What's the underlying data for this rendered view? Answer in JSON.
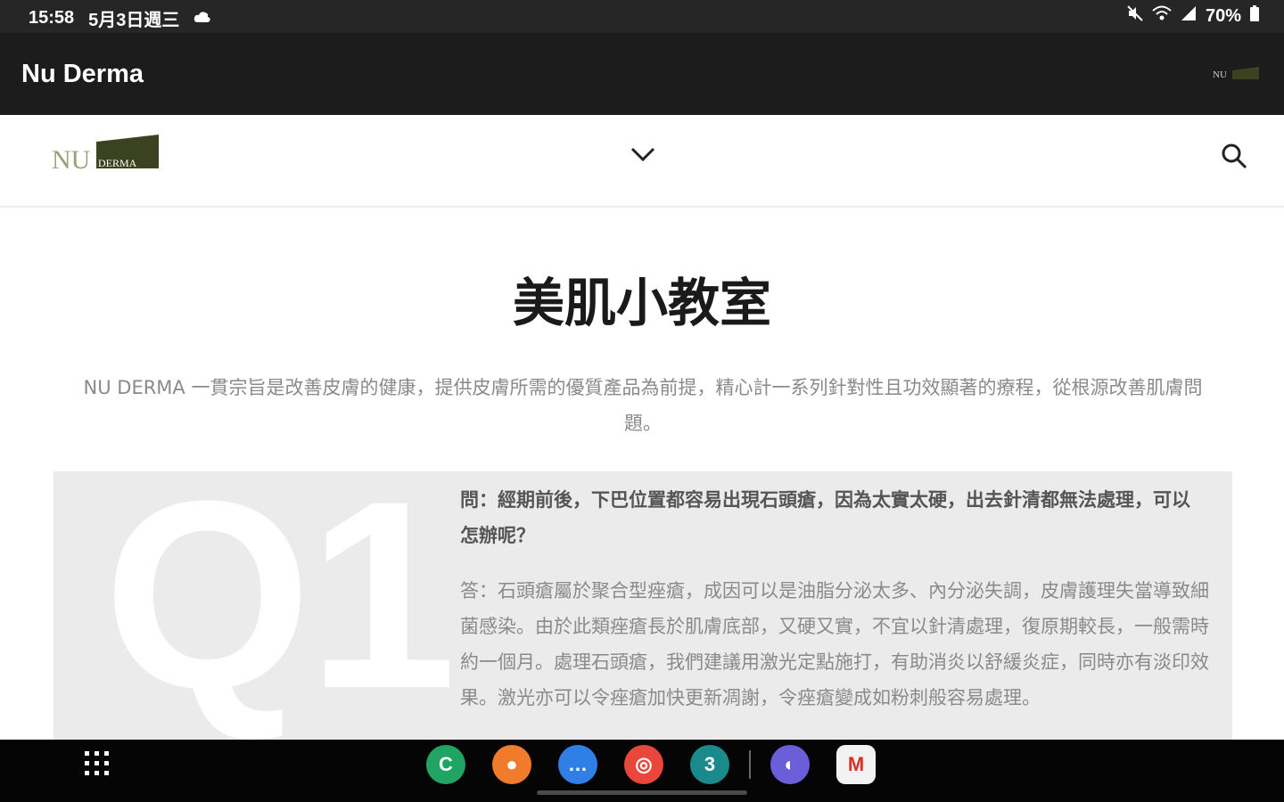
{
  "status_bar": {
    "time": "15:58",
    "date": "5月3日週三",
    "battery": "70%",
    "icons": [
      "cloud-icon",
      "mute-icon",
      "wifi-icon",
      "signal-icon",
      "battery-icon"
    ]
  },
  "app_bar": {
    "title": "Nu Derma",
    "mini_logo_text": "NU"
  },
  "site_header": {
    "logo_text_nu": "NU",
    "logo_text_derma": "DERMA",
    "logo_color": "#3a4220",
    "logo_nu_color": "#9aa07a"
  },
  "page": {
    "title": "美肌小教室",
    "intro": "NU DERMA 一貫宗旨是改善皮膚的健康，提供皮膚所需的優質產品為前提，精心計一系列針對性且功效顯著的療程，從根源改善肌膚問題。"
  },
  "faq": [
    {
      "number": "Q1",
      "question": "問：經期前後，下巴位置都容易出現石頭瘡，因為太實太硬，出去針清都無法處理，可以怎辦呢？",
      "answer": "答：石頭瘡屬於聚合型痤瘡，成因可以是油脂分泌太多、內分泌失調，皮膚護理失當導致細菌感染。由於此類痤瘡長於肌膚底部，又硬又實，不宜以針清處理，復原期較長，一般需時約一個月。處理石頭瘡，我們建議用激光定點施打，有助消炎以舒緩炎症，同時亦有淡印效果。激光亦可以令痤瘡加快更新凋謝，令痤瘡變成如粉刺般容易處理。"
    }
  ],
  "dock": {
    "apps": [
      {
        "name": "phone-app-icon",
        "glyph": "C",
        "color": "#1fa463"
      },
      {
        "name": "contacts-app-icon",
        "glyph": "●",
        "color": "#f07b2a"
      },
      {
        "name": "messages-app-icon",
        "glyph": "…",
        "color": "#2f7fe6"
      },
      {
        "name": "chrome-app-icon",
        "glyph": "◎",
        "color": "#e9473b"
      },
      {
        "name": "calendar-app-icon",
        "glyph": "3",
        "color": "#1a8a8c"
      },
      {
        "name": "internet-app-icon",
        "glyph": "◐",
        "color": "#6a5fd8"
      },
      {
        "name": "gmail-app-icon",
        "glyph": "M",
        "color": "#f2f2f2"
      }
    ]
  }
}
